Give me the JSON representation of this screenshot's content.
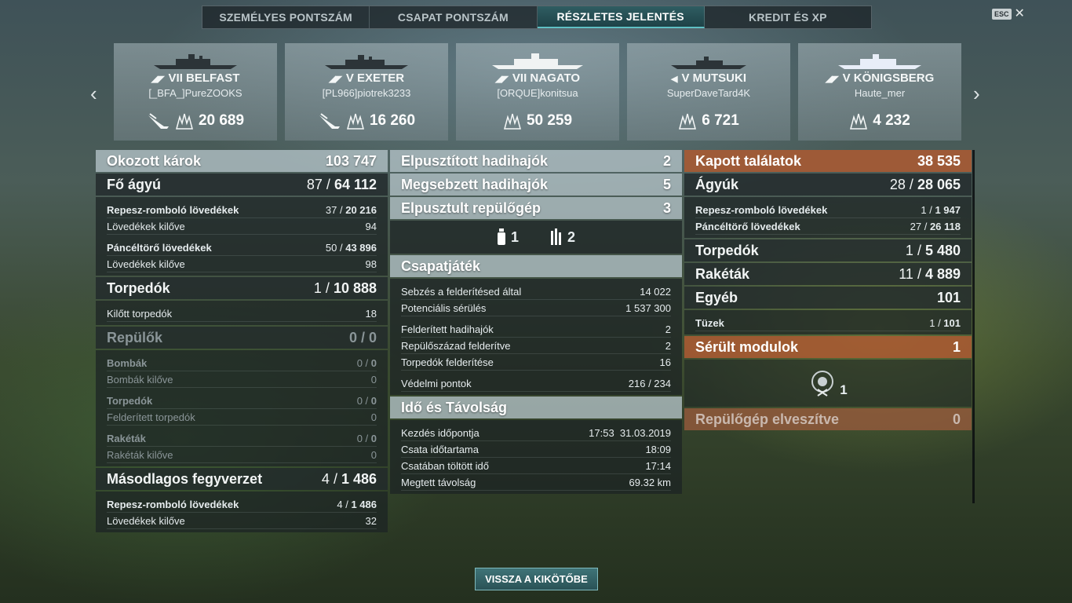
{
  "tabs": [
    "SZEMÉLYES PONTSZÁM",
    "CSAPAT PONTSZÁM",
    "RÉSZLETES JELENTÉS",
    "KREDIT ÉS XP"
  ],
  "active_tab": "RÉSZLETES JELENTÉS",
  "esc_label": "ESC",
  "close_glyph": "✕",
  "nav": {
    "prev": "‹",
    "next": "›"
  },
  "players": [
    {
      "tier": "VII",
      "ship": "BELFAST",
      "player": "[_BFA_]PureZOOKS",
      "damage": "20 689",
      "class_icon": "cruiser-icon"
    },
    {
      "tier": "V",
      "ship": "EXETER",
      "player": "[PL966]piotrek3233",
      "damage": "16 260",
      "class_icon": "cruiser-icon"
    },
    {
      "tier": "VII",
      "ship": "NAGATO",
      "player": "[ORQUE]konitsua",
      "damage": "50 259",
      "class_icon": "battleship-icon"
    },
    {
      "tier": "V",
      "ship": "MUTSUKI",
      "player": "SuperDaveTard4K",
      "damage": "6 721",
      "class_icon": "destroyer-icon"
    },
    {
      "tier": "V",
      "ship": "KÖNIGSBERG",
      "player": "Haute_mer",
      "damage": "4 232",
      "class_icon": "cruiser-icon"
    }
  ],
  "left": {
    "damage_caused": {
      "label": "Okozott károk",
      "value": "103 747"
    },
    "main_battery": {
      "label": "Fő ágyú",
      "hits": "87",
      "damage": "64 112"
    },
    "he_shells": {
      "label": "Repesz-romboló lövedékek",
      "hits": "37",
      "damage": "20 216",
      "fired_label": "Lövedékek kilőve",
      "fired": "94"
    },
    "ap_shells": {
      "label": "Páncéltörő lövedékek",
      "hits": "50",
      "damage": "43 896",
      "fired_label": "Lövedékek kilőve",
      "fired": "98"
    },
    "torpedoes": {
      "label": "Torpedók",
      "hits": "1",
      "damage": "10 888",
      "fired_label": "Kilőtt torpedók",
      "fired": "18"
    },
    "aircraft": {
      "label": "Repülők",
      "hits": "0",
      "damage": "0"
    },
    "bombs": {
      "label": "Bombák",
      "hits": "0",
      "damage": "0",
      "fired_label": "Bombák kilőve",
      "fired": "0"
    },
    "air_torpedoes": {
      "label": "Torpedók",
      "hits": "0",
      "damage": "0",
      "fired_label": "Felderített torpedók",
      "fired": "0"
    },
    "rockets": {
      "label": "Rakéták",
      "hits": "0",
      "damage": "0",
      "fired_label": "Rakéták kilőve",
      "fired": "0"
    },
    "secondary": {
      "label": "Másodlagos fegyverzet",
      "hits": "4",
      "damage": "1 486"
    },
    "sec_he": {
      "label": "Repesz-romboló lövedékek",
      "hits": "4",
      "damage": "1 486",
      "fired_label": "Lövedékek kilőve",
      "fired": "32"
    }
  },
  "middle": {
    "ships_destroyed": {
      "label": "Elpusztított hadihajók",
      "value": "2"
    },
    "ships_damaged": {
      "label": "Megsebzett hadihajók",
      "value": "5"
    },
    "planes_destroyed": {
      "label": "Elpusztult repülőgép",
      "value": "3"
    },
    "icon_counts": {
      "fighter": "1",
      "bomber": "2"
    },
    "teamplay": {
      "title": "Csapatjáték",
      "rows": [
        {
          "label": "Sebzés a felderítésed által",
          "value": "14 022"
        },
        {
          "label": "Potenciális sérülés",
          "value": "1 537 300"
        },
        {
          "label": "Felderített hadihajók",
          "value": "2"
        },
        {
          "label": "Repülőszázad felderítve",
          "value": "2"
        },
        {
          "label": "Torpedók felderítése",
          "value": "16"
        },
        {
          "label": "Védelmi pontok",
          "value": "216 / 234"
        }
      ]
    },
    "time": {
      "title": "Idő és Távolság",
      "rows": [
        {
          "label": "Kezdés időpontja",
          "value": "17:53  31.03.2019"
        },
        {
          "label": "Csata időtartama",
          "value": "18:09"
        },
        {
          "label": "Csatában töltött idő",
          "value": "17:14"
        },
        {
          "label": "Megtett távolság",
          "value": "69.32 km"
        }
      ]
    }
  },
  "right": {
    "hits_received": {
      "label": "Kapott találatok",
      "value": "38 535"
    },
    "guns": {
      "label": "Ágyúk",
      "hits": "28",
      "damage": "28 065"
    },
    "he": {
      "label": "Repesz-romboló lövedékek",
      "hits": "1",
      "damage": "1 947"
    },
    "ap": {
      "label": "Páncéltörő lövedékek",
      "hits": "27",
      "damage": "26 118"
    },
    "torpedoes": {
      "label": "Torpedók",
      "hits": "1",
      "damage": "5 480"
    },
    "rockets": {
      "label": "Rakéták",
      "hits": "11",
      "damage": "4 889"
    },
    "other": {
      "label": "Egyéb",
      "value": "101"
    },
    "fires": {
      "label": "Tüzek",
      "hits": "1",
      "damage": "101"
    },
    "damaged_modules": {
      "label": "Sérült modulok",
      "value": "1"
    },
    "module_count": "1",
    "planes_lost": {
      "label": "Repülőgép elveszítve",
      "value": "0"
    }
  },
  "back_button": "VISSZA A KIKÖTŐBE",
  "colors": {
    "accent": "#2f5d62",
    "orange": "#aa5a32"
  }
}
